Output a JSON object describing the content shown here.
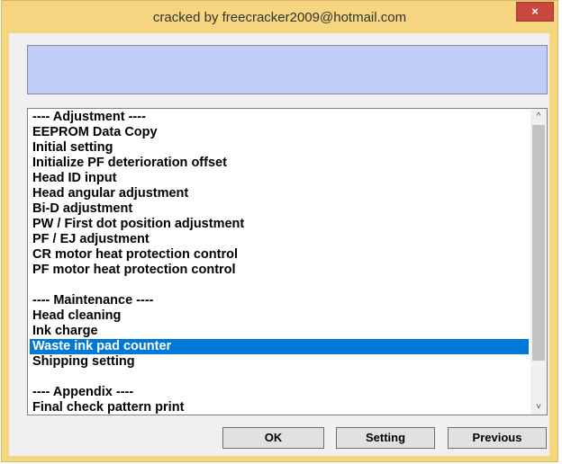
{
  "window": {
    "title": "cracked by freecracker2009@hotmail.com",
    "close_glyph": "×"
  },
  "message_box": {
    "text": ""
  },
  "list": {
    "items": [
      {
        "label": "---- Adjustment ----",
        "selected": false
      },
      {
        "label": "EEPROM Data Copy",
        "selected": false
      },
      {
        "label": "Initial setting",
        "selected": false
      },
      {
        "label": "Initialize PF deterioration offset",
        "selected": false
      },
      {
        "label": "Head ID input",
        "selected": false
      },
      {
        "label": "Head angular adjustment",
        "selected": false
      },
      {
        "label": "Bi-D adjustment",
        "selected": false
      },
      {
        "label": "PW / First dot position adjustment",
        "selected": false
      },
      {
        "label": "PF / EJ adjustment",
        "selected": false
      },
      {
        "label": "CR motor heat protection control",
        "selected": false
      },
      {
        "label": "PF motor heat protection control",
        "selected": false
      },
      {
        "label": "",
        "selected": false
      },
      {
        "label": "---- Maintenance ----",
        "selected": false
      },
      {
        "label": "Head cleaning",
        "selected": false
      },
      {
        "label": "Ink charge",
        "selected": false
      },
      {
        "label": "Waste ink pad counter",
        "selected": true
      },
      {
        "label": "Shipping setting",
        "selected": false
      },
      {
        "label": "",
        "selected": false
      },
      {
        "label": "---- Appendix ----",
        "selected": false
      },
      {
        "label": "Final check pattern print",
        "selected": false
      }
    ]
  },
  "scrollbar": {
    "up_glyph": "^",
    "down_glyph": "˅"
  },
  "buttons": {
    "ok": "OK",
    "setting": "Setting",
    "previous": "Previous"
  },
  "colors": {
    "frame": "#F5D57F",
    "selection": "#0078D7",
    "message_box": "#C0CEF7",
    "close_button": "#c9473f"
  }
}
